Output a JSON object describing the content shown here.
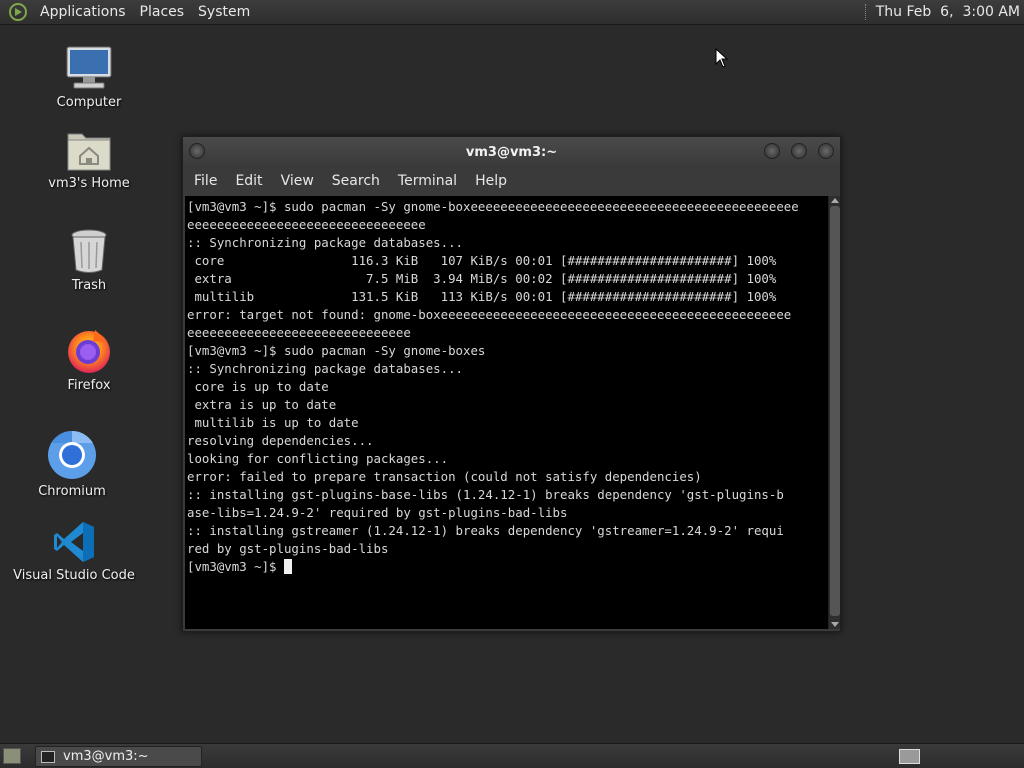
{
  "top_panel": {
    "menus": [
      "Applications",
      "Places",
      "System"
    ],
    "clock": "Thu Feb  6,  3:00 AM"
  },
  "desktop": {
    "icons": [
      {
        "label": "Computer",
        "icon": "computer-icon"
      },
      {
        "label": "vm3's Home",
        "icon": "home-folder-icon"
      },
      {
        "label": "Trash",
        "icon": "trash-icon"
      },
      {
        "label": "Firefox",
        "icon": "firefox-icon"
      },
      {
        "label": "Chromium",
        "icon": "chromium-icon"
      },
      {
        "label": "Visual Studio Code",
        "icon": "vscode-icon"
      }
    ]
  },
  "terminal_window": {
    "title": "vm3@vm3:~",
    "menus": [
      "File",
      "Edit",
      "View",
      "Search",
      "Terminal",
      "Help"
    ],
    "lines": [
      "[vm3@vm3 ~]$ sudo pacman -Sy gnome-boxeeeeeeeeeeeeeeeeeeeeeeeeeeeeeeeeeeeeeeeeeeee",
      "eeeeeeeeeeeeeeeeeeeeeeeeeeeeeeee",
      ":: Synchronizing package databases...",
      " core                 116.3 KiB   107 KiB/s 00:01 [######################] 100%",
      " extra                  7.5 MiB  3.94 MiB/s 00:02 [######################] 100%",
      " multilib             131.5 KiB   113 KiB/s 00:01 [######################] 100%",
      "error: target not found: gnome-boxeeeeeeeeeeeeeeeeeeeeeeeeeeeeeeeeeeeeeeeeeeeeeee",
      "eeeeeeeeeeeeeeeeeeeeeeeeeeeeee",
      "[vm3@vm3 ~]$ sudo pacman -Sy gnome-boxes",
      ":: Synchronizing package databases...",
      " core is up to date",
      " extra is up to date",
      " multilib is up to date",
      "resolving dependencies...",
      "looking for conflicting packages...",
      "error: failed to prepare transaction (could not satisfy dependencies)",
      ":: installing gst-plugins-base-libs (1.24.12-1) breaks dependency 'gst-plugins-b",
      "ase-libs=1.24.9-2' required by gst-plugins-bad-libs",
      ":: installing gstreamer (1.24.12-1) breaks dependency 'gstreamer=1.24.9-2' requi",
      "red by gst-plugins-bad-libs"
    ],
    "prompt": "[vm3@vm3 ~]$ "
  },
  "bottom_panel": {
    "task_label": "vm3@vm3:~"
  }
}
